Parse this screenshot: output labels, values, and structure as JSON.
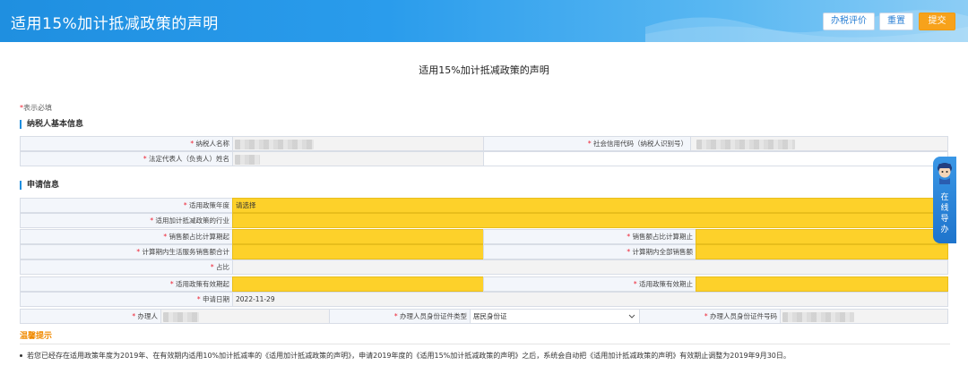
{
  "header": {
    "title": "适用15%加计抵减政策的声明",
    "buttons": {
      "eval": "办税评价",
      "reset": "重置",
      "submit": "提交"
    }
  },
  "form_title": "适用15%加计抵减政策的声明",
  "required_note": {
    "star": "*",
    "text": "表示必填"
  },
  "section_basic": {
    "title": "纳税人基本信息",
    "taxpayer_name_label": "纳税人名称",
    "credit_code_label": "社会信用代码（纳税人识别号）",
    "legal_rep_label": "法定代表人（负责人）姓名"
  },
  "section_apply": {
    "title": "申请信息",
    "policy_year_label": "适用政策年度",
    "policy_year_value": "请选择",
    "industry_label": "适用加计抵减政策的行业",
    "sales_ratio_start_label": "销售额占比计算期起",
    "sales_ratio_end_label": "销售额占比计算期止",
    "service_sales_label": "计算期内生活服务销售额合计",
    "total_sales_label": "计算期内全部销售额",
    "ratio_label": "占比",
    "valid_start_label": "适用政策有效期起",
    "valid_end_label": "适用政策有效期止",
    "apply_date_label": "申请日期",
    "apply_date_value": "2022-11-29",
    "handler_label": "办理人",
    "id_type_label": "办理人员身份证件类型",
    "id_type_value": "居民身份证",
    "id_no_label": "办理人员身份证件号码"
  },
  "tips": {
    "title": "温馨提示",
    "text": "若您已经存在适用政策年度为2019年、在有效期内适用10%加计抵减率的《适用加计抵减政策的声明》，申请2019年度的《适用15%加计抵减政策的声明》之后，系统会自动把《适用加计抵减政策的声明》有效期止调整为2019年9月30日。"
  },
  "online_guide": {
    "text": "在线导办"
  },
  "colors": {
    "header_blue": "#1f8fe0",
    "required_yellow": "#fdd12a",
    "submit_orange": "#f7a21b",
    "tip_orange": "#f08a00"
  }
}
